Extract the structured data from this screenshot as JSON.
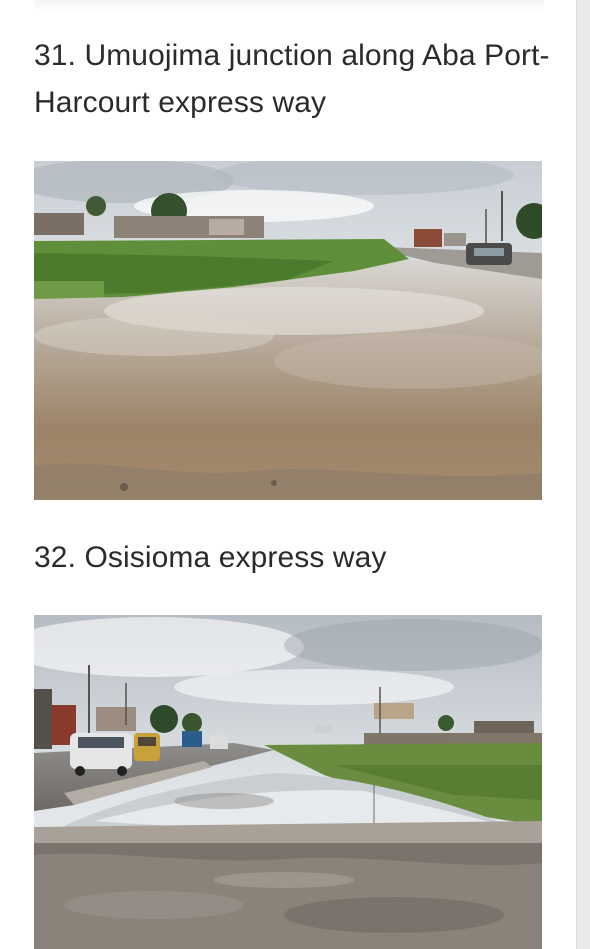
{
  "article": {
    "items": [
      {
        "heading": "31. Umuojima junction along Aba Port-Harcourt express way",
        "photo_subject": "flooded-roadside"
      },
      {
        "heading": "32. Osisioma express way",
        "photo_subject": "flooded-road-with-vehicles"
      }
    ]
  },
  "colors": {
    "heading_text": "#2b2b2b",
    "background": "#ffffff",
    "scrollbar_track": "#e9e9e9"
  }
}
